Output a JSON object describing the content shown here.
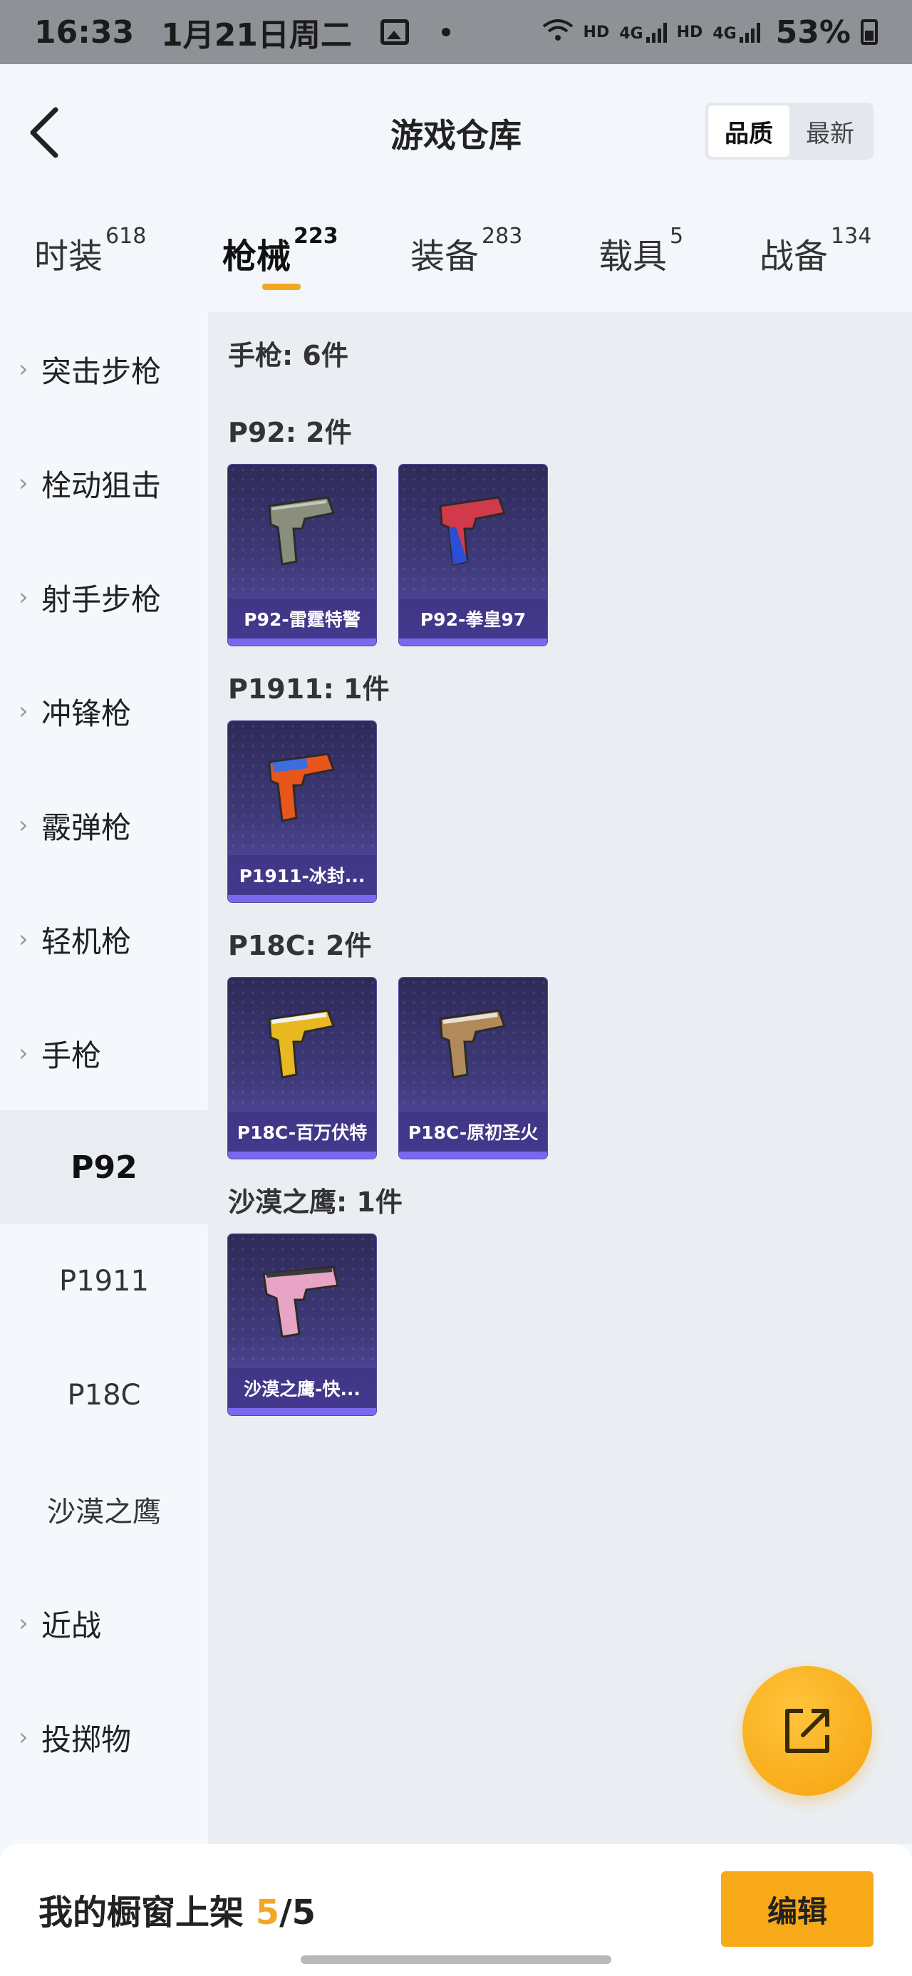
{
  "status_bar": {
    "time": "16:33",
    "date": "1月21日周二",
    "network_1": "HD",
    "network_2": "HD",
    "gen": "4G",
    "battery": "53%"
  },
  "header": {
    "title": "游戏仓库",
    "sort_options": [
      "品质",
      "最新"
    ],
    "sort_active": "品质"
  },
  "tabs": [
    {
      "label": "时装",
      "count": "618"
    },
    {
      "label": "枪械",
      "count": "223",
      "active": true
    },
    {
      "label": "装备",
      "count": "283"
    },
    {
      "label": "载具",
      "count": "5"
    },
    {
      "label": "战备",
      "count": "134"
    }
  ],
  "sidebar": {
    "categories": [
      "突击步枪",
      "栓动狙击",
      "射手步枪",
      "冲锋枪",
      "霰弹枪",
      "轻机枪",
      "手枪"
    ],
    "sub_items": [
      "P92",
      "P1911",
      "P18C",
      "沙漠之鹰"
    ],
    "selected_sub": "P92",
    "after": [
      "近战",
      "投掷物"
    ]
  },
  "content": {
    "total": "手枪: 6件",
    "groups": [
      {
        "title": "P92: 2件",
        "items": [
          "P92-雷霆特警",
          "P92-拳皇97"
        ]
      },
      {
        "title": "P1911: 1件",
        "items": [
          "P1911-冰封..."
        ]
      },
      {
        "title": "P18C: 2件",
        "items": [
          "P18C-百万伏特",
          "P18C-原初圣火"
        ]
      },
      {
        "title": "沙漠之鹰: 1件",
        "items": [
          "沙漠之鹰-快..."
        ]
      }
    ]
  },
  "bottom": {
    "showcase_label": "我的橱窗上架",
    "current": "5",
    "separator_total": "/5",
    "edit_label": "编辑"
  },
  "colors": {
    "accent": "#f5a623",
    "card_bg": "#3f3a7a"
  }
}
